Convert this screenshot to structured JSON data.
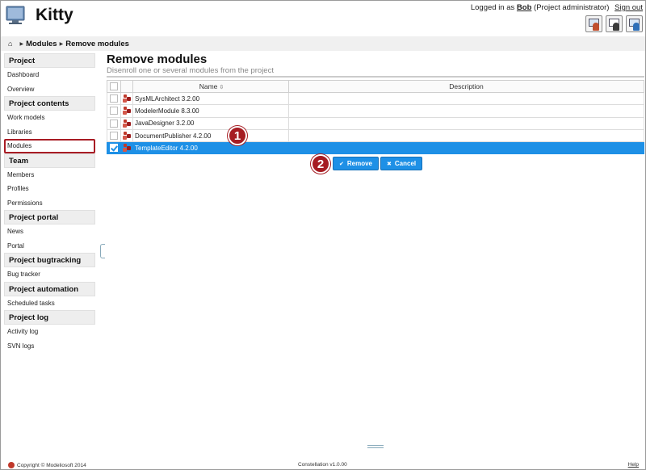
{
  "app": {
    "title": "Kitty"
  },
  "login": {
    "prefix": "Logged in as",
    "user": "Bob",
    "role": "(Project administrator)",
    "signout": "Sign out"
  },
  "header_icons": [
    "workspace-icon",
    "user-profile-icon",
    "admin-settings-icon"
  ],
  "breadcrumb": {
    "home_icon": "home-icon",
    "items": [
      "Modules",
      "Remove modules"
    ]
  },
  "sidebar": {
    "sections": [
      {
        "title": "Project",
        "items": [
          "Dashboard",
          "Overview"
        ]
      },
      {
        "title": "Project contents",
        "items": [
          "Work models",
          "Libraries",
          "Modules"
        ]
      },
      {
        "title": "Team",
        "items": [
          "Members",
          "Profiles",
          "Permissions"
        ]
      },
      {
        "title": "Project portal",
        "items": [
          "News",
          "Portal"
        ]
      },
      {
        "title": "Project bugtracking",
        "items": [
          "Bug tracker"
        ]
      },
      {
        "title": "Project automation",
        "items": [
          "Scheduled tasks"
        ]
      },
      {
        "title": "Project log",
        "items": [
          "Activity log",
          "SVN logs"
        ]
      }
    ],
    "active_item": "Modules"
  },
  "main": {
    "title": "Remove modules",
    "subtitle": "Disenroll one or several modules from the project",
    "table": {
      "columns": [
        "Name",
        "Description"
      ],
      "rows": [
        {
          "name": "SysMLArchitect 3.2.00",
          "description": "",
          "checked": false
        },
        {
          "name": "ModelerModule 8.3.00",
          "description": "",
          "checked": false
        },
        {
          "name": "JavaDesigner 3.2.00",
          "description": "",
          "checked": false
        },
        {
          "name": "DocumentPublisher 4.2.00",
          "description": "",
          "checked": false
        },
        {
          "name": "TemplateEditor 4.2.00",
          "description": "",
          "checked": true
        }
      ]
    },
    "buttons": {
      "remove": "Remove",
      "cancel": "Cancel"
    }
  },
  "badges": [
    "1",
    "2"
  ],
  "footer": {
    "copyright": "Copyright © Modeliosoft 2014",
    "version": "Constellation v1.0.00",
    "help": "Help"
  },
  "colors": {
    "selection": "#1e90e6",
    "badge": "#a61c22",
    "active_border": "#a81c24"
  }
}
